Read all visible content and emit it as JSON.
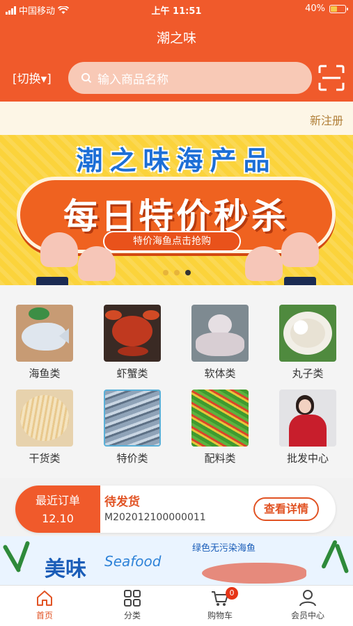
{
  "status_bar": {
    "carrier": "中国移动",
    "time": "上午 11:51",
    "battery": "40%",
    "battery_level": 0.4
  },
  "header": {
    "title": "潮之味",
    "switch_label": "[切换▾]",
    "search_placeholder": "输入商品名称",
    "scan_icon": "scan-icon"
  },
  "register_label": "新注册",
  "banner": {
    "brand": "潮之味海产品",
    "promo_title": "每日特价秒杀",
    "promo_sub": "特价海鱼点击抢购",
    "slide_count": 3,
    "active_slide": 3
  },
  "categories": [
    {
      "label": "海鱼类",
      "icon": "pomfret-fish-photo"
    },
    {
      "label": "虾蟹类",
      "icon": "crab-photo"
    },
    {
      "label": "软体类",
      "icon": "octopus-photo"
    },
    {
      "label": "丸子类",
      "icon": "fish-balls-photo"
    },
    {
      "label": "干货类",
      "icon": "dried-squid-photo"
    },
    {
      "label": "特价类",
      "icon": "small-fish-photo"
    },
    {
      "label": "配料类",
      "icon": "vegetables-photo"
    },
    {
      "label": "批发中心",
      "icon": "wholesale-photo"
    }
  ],
  "recent_order": {
    "label": "最近订单",
    "date": "12.10",
    "status": "待发货",
    "order_no": "M202012100000011",
    "detail_button": "查看详情"
  },
  "bottom_banner": {
    "title": "美味",
    "english": "Seafood",
    "tag": "绿色无污染海鱼"
  },
  "tabbar": {
    "tabs": [
      {
        "label": "首页",
        "icon": "home-icon"
      },
      {
        "label": "分类",
        "icon": "grid-icon"
      },
      {
        "label": "购物车",
        "icon": "cart-icon"
      },
      {
        "label": "会员中心",
        "icon": "user-icon"
      }
    ],
    "cart_count": "0"
  },
  "colors": {
    "brand": "#f05a2b",
    "banner_yellow": "#fbd33b",
    "active_tab": "#e15324"
  }
}
